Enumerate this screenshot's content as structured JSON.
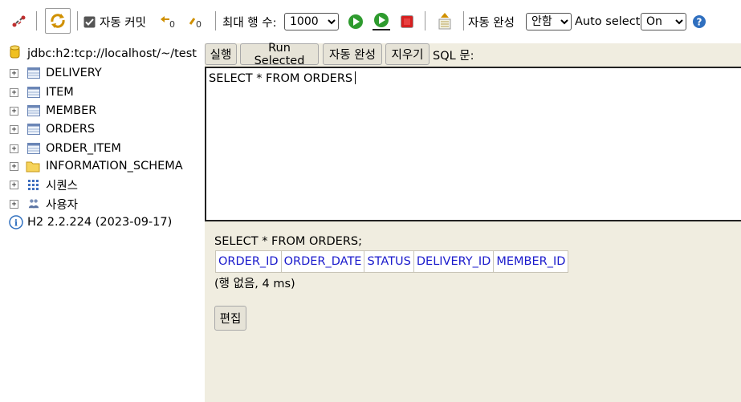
{
  "toolbar": {
    "auto_commit_label": "자동 커밋",
    "auto_commit_checked": true,
    "max_rows_label": "최대 행 수:",
    "max_rows_value": "1000",
    "autocomplete_label": "자동 완성",
    "autocomplete_value": "안함",
    "auto_select_label": "Auto select",
    "auto_select_value": "On",
    "colors": {
      "run_green": "#2e9b2e",
      "stop_red": "#d62020",
      "help_blue": "#2f6fbf"
    }
  },
  "tree": {
    "connection": "jdbc:h2:tcp://localhost/~/test",
    "tables": [
      "DELIVERY",
      "ITEM",
      "MEMBER",
      "ORDERS",
      "ORDER_ITEM"
    ],
    "schema": "INFORMATION_SCHEMA",
    "sequences": "시퀀스",
    "users": "사용자",
    "version": "H2 2.2.224 (2023-09-17)"
  },
  "query": {
    "buttons": {
      "run": "실행",
      "run_selected": "Run Selected",
      "autocomplete": "자동 완성",
      "clear": "지우기"
    },
    "sql_label": "SQL 문:",
    "editor_text": "SELECT * FROM ORDERS"
  },
  "result": {
    "sql": "SELECT * FROM ORDERS;",
    "columns": [
      "ORDER_ID",
      "ORDER_DATE",
      "STATUS",
      "DELIVERY_ID",
      "MEMBER_ID"
    ],
    "rows_info": "(행 없음, 4 ms)",
    "edit_button": "편집"
  }
}
